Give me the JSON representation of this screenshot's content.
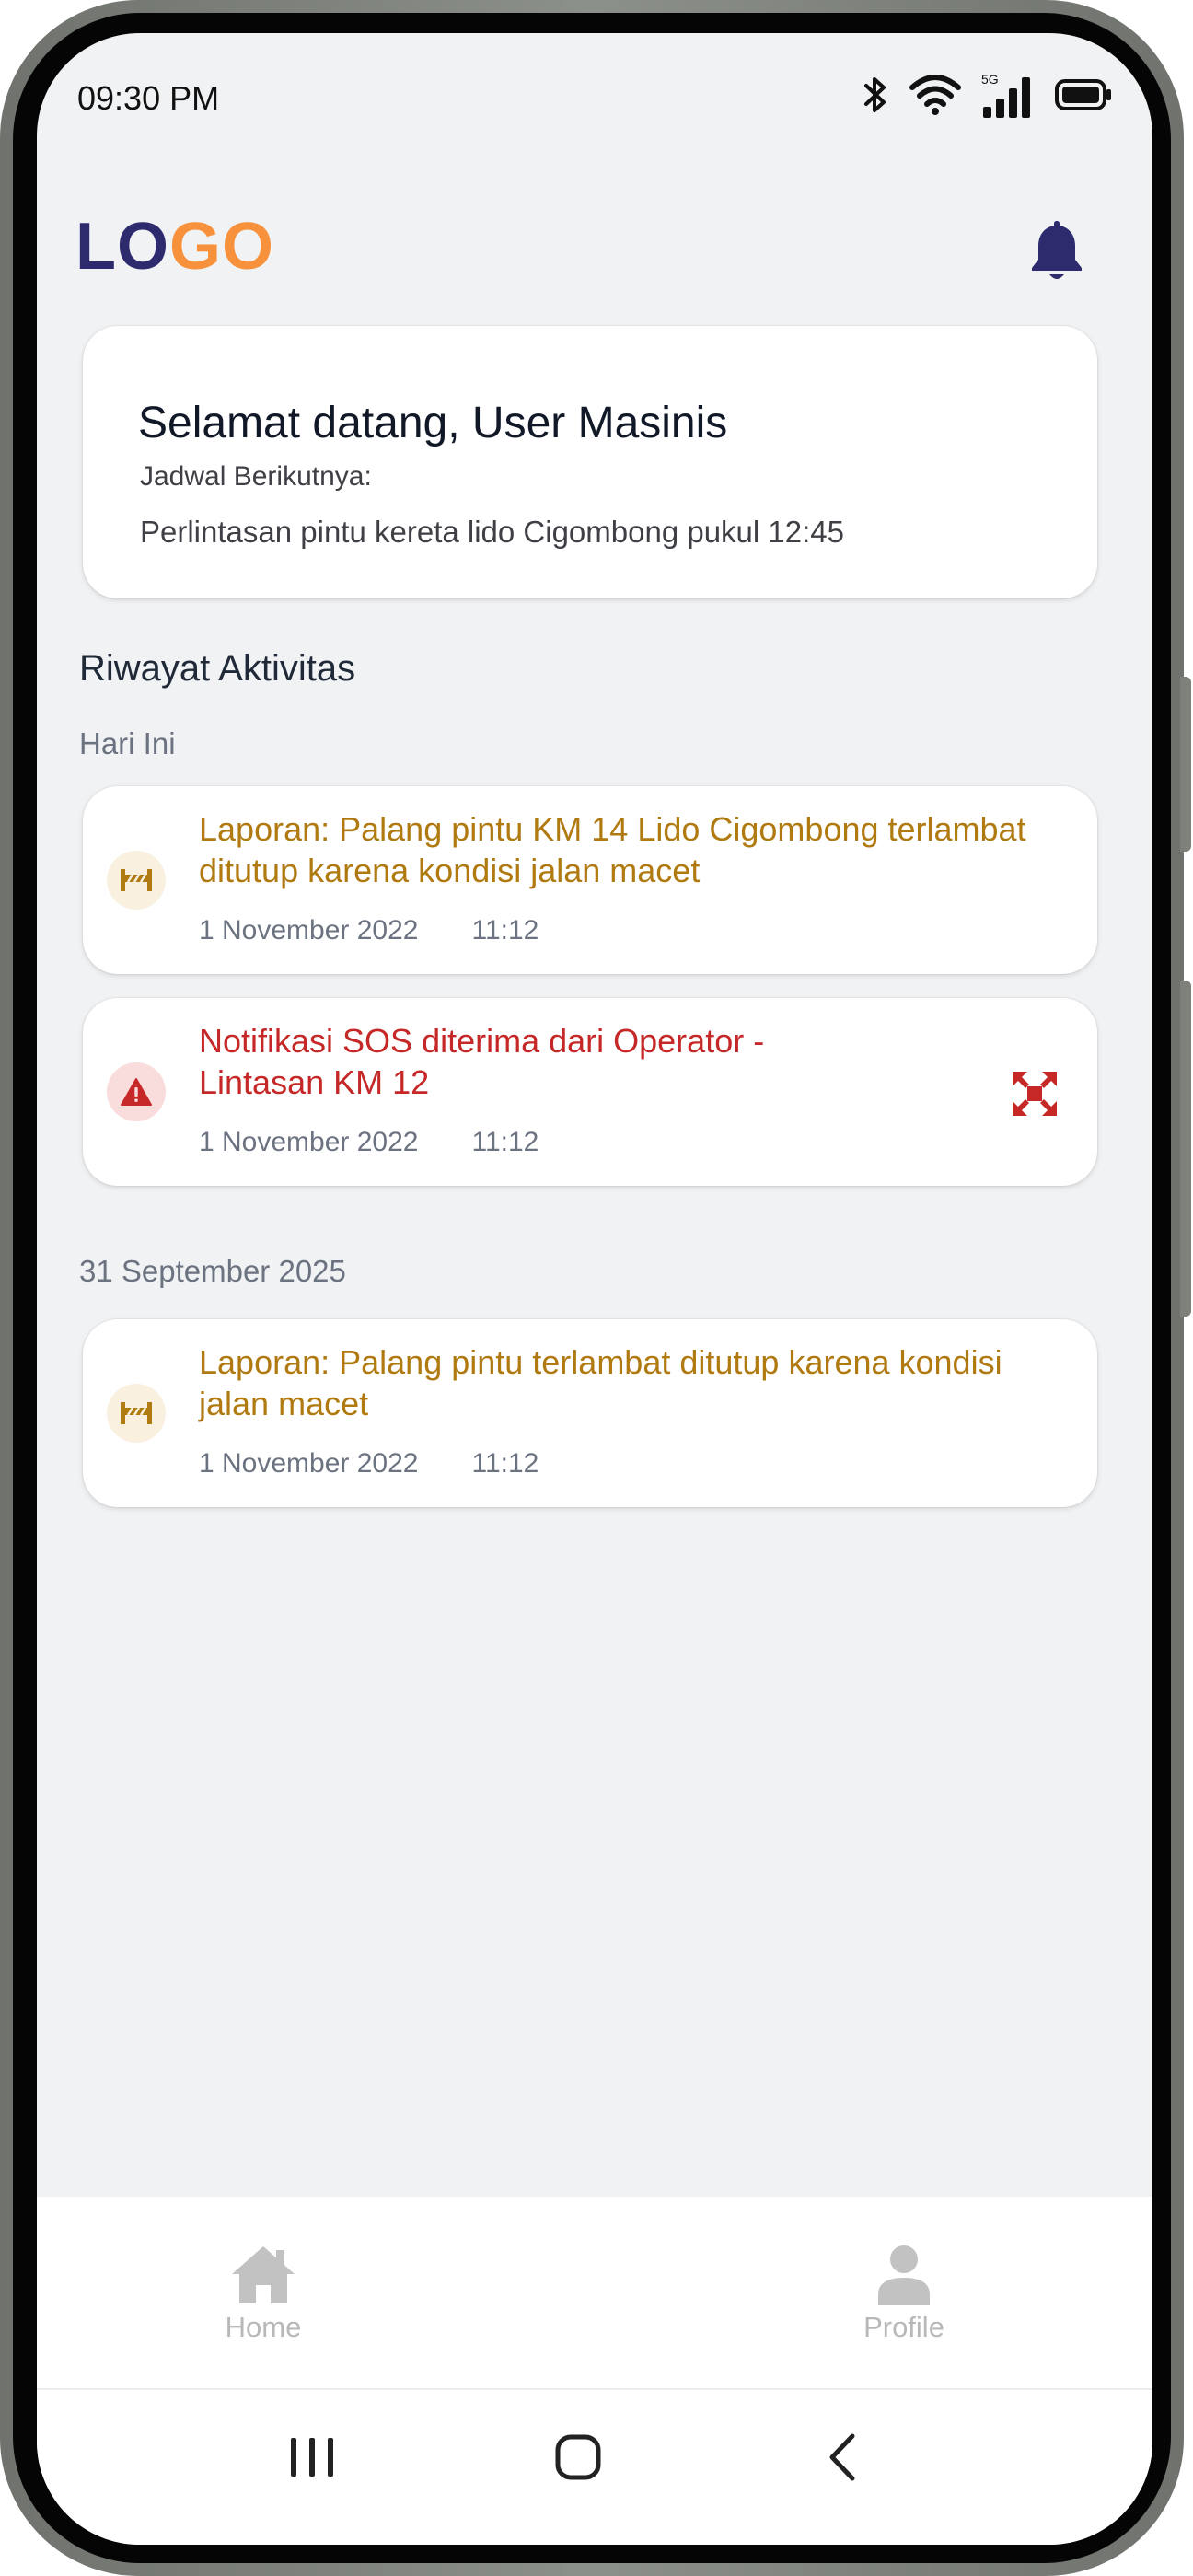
{
  "status_bar": {
    "time": "09:30 PM",
    "icons": [
      "bluetooth-icon",
      "wifi-icon",
      "signal-5g-icon",
      "battery-icon"
    ],
    "network_label": "5G"
  },
  "header": {
    "logo_part1": "LO",
    "logo_part2": "GO",
    "logo_colors": {
      "primary": "#2d2a6e",
      "accent": "#f7913b"
    },
    "notification_icon": "bell-icon"
  },
  "welcome": {
    "title": "Selamat datang, User Masinis",
    "subtitle": "Jadwal Berikutnya:",
    "schedule": "Perlintasan pintu kereta lido Cigombong pukul 12:45"
  },
  "history": {
    "title": "Riwayat Aktivitas",
    "groups": [
      {
        "label": "Hari Ini",
        "items": [
          {
            "type": "warning",
            "icon": "barrier-icon",
            "title": "Laporan: Palang pintu KM 14 Lido Cigombong terlambat ditutup karena kondisi jalan macet",
            "date": "1 November 2022",
            "time": "11:12"
          },
          {
            "type": "sos",
            "icon": "alert-triangle-icon",
            "title": "Notifikasi SOS diterima dari Operator - Lintasan KM 12",
            "date": "1 November 2022",
            "time": "11:12",
            "action_icon": "expand-icon"
          }
        ]
      },
      {
        "label": "31 September 2025",
        "items": [
          {
            "type": "warning",
            "icon": "barrier-icon",
            "title": "Laporan: Palang pintu terlambat ditutup karena kondisi jalan macet",
            "date": "1 November 2022",
            "time": "11:12"
          }
        ]
      }
    ]
  },
  "colors": {
    "warning": "#b07a10",
    "sos": "#c62828",
    "background": "#f1f2f4"
  },
  "bottom_nav": {
    "items": [
      {
        "label": "Home",
        "icon": "home-icon"
      },
      {
        "label": "Profile",
        "icon": "user-icon"
      }
    ]
  },
  "system_nav": [
    "recent-apps-icon",
    "home-circle-icon",
    "back-icon"
  ]
}
